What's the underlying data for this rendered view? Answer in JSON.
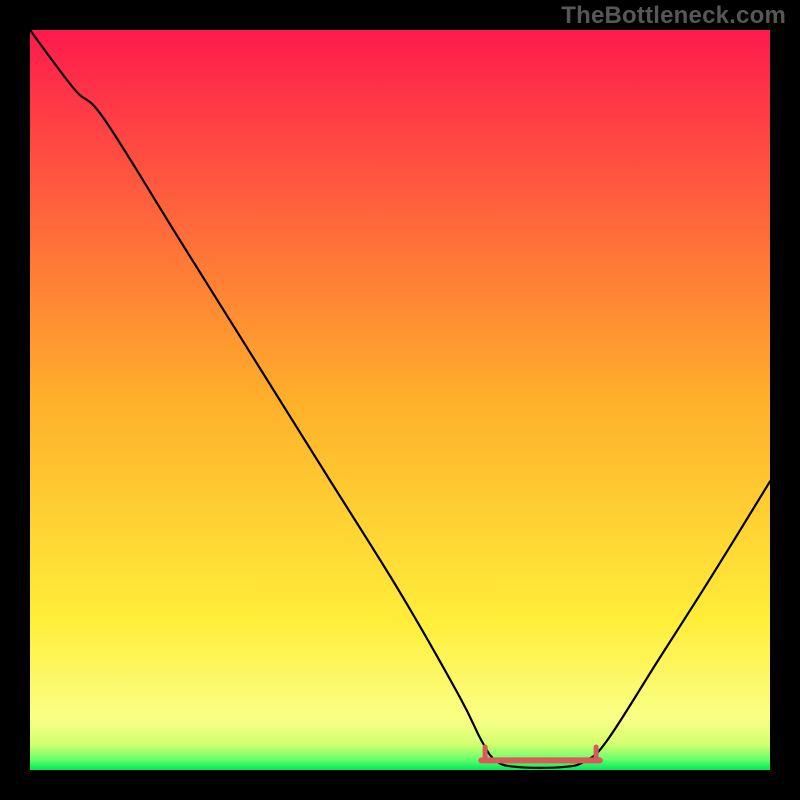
{
  "watermark": "TheBottleneck.com",
  "colors": {
    "background": "#000000",
    "curve": "#000000",
    "accent": "#d85a5a",
    "gradient_stops": [
      {
        "offset": 0.0,
        "color": "#ff1a4d"
      },
      {
        "offset": 0.5,
        "color": "#ffb02a"
      },
      {
        "offset": 0.8,
        "color": "#ffee3a"
      },
      {
        "offset": 0.93,
        "color": "#faff86"
      },
      {
        "offset": 0.965,
        "color": "#d4ff70"
      },
      {
        "offset": 0.985,
        "color": "#6cff6c"
      },
      {
        "offset": 1.0,
        "color": "#00e85a"
      }
    ]
  },
  "chart_data": {
    "type": "line",
    "title": "",
    "xlabel": "",
    "ylabel": "",
    "xlim": [
      0,
      100
    ],
    "ylim": [
      0,
      100
    ],
    "curve": [
      {
        "x": 0,
        "y": 100
      },
      {
        "x": 6,
        "y": 92
      },
      {
        "x": 10,
        "y": 88
      },
      {
        "x": 20,
        "y": 72
      },
      {
        "x": 30,
        "y": 56
      },
      {
        "x": 40,
        "y": 40
      },
      {
        "x": 50,
        "y": 24
      },
      {
        "x": 58,
        "y": 10
      },
      {
        "x": 61,
        "y": 4
      },
      {
        "x": 63,
        "y": 1.2
      },
      {
        "x": 66,
        "y": 0.4
      },
      {
        "x": 72,
        "y": 0.4
      },
      {
        "x": 75,
        "y": 1.2
      },
      {
        "x": 78,
        "y": 4
      },
      {
        "x": 85,
        "y": 15
      },
      {
        "x": 92,
        "y": 26
      },
      {
        "x": 100,
        "y": 39
      }
    ],
    "accent_segment": {
      "x_start": 61,
      "x_end": 77,
      "y": 1.3
    },
    "accent_endcaps": [
      {
        "x": 61.5,
        "y": 2.3
      },
      {
        "x": 76.5,
        "y": 2.3
      }
    ]
  }
}
